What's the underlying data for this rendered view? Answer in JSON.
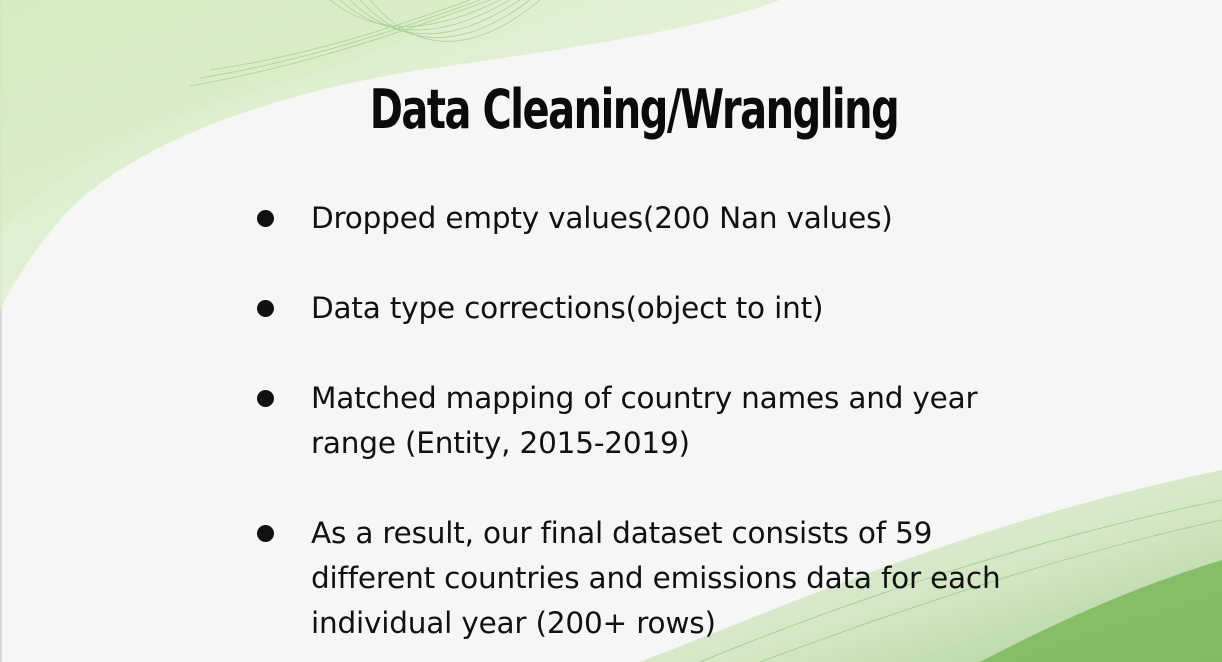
{
  "slide": {
    "title": "Data Cleaning/Wrangling",
    "bullets": [
      "Dropped empty values(200 Nan values)",
      "Data type corrections(object to int)",
      "Matched mapping of country names and year range (Entity, 2015-2019)",
      "As a result, our final dataset consists of 59 different countries and emissions data for each individual year (200+ rows)"
    ]
  },
  "colors": {
    "background": "#f6f6f5",
    "accent_green": "#7ab85a",
    "light_green": "#e3f3d4",
    "text": "#111111"
  }
}
